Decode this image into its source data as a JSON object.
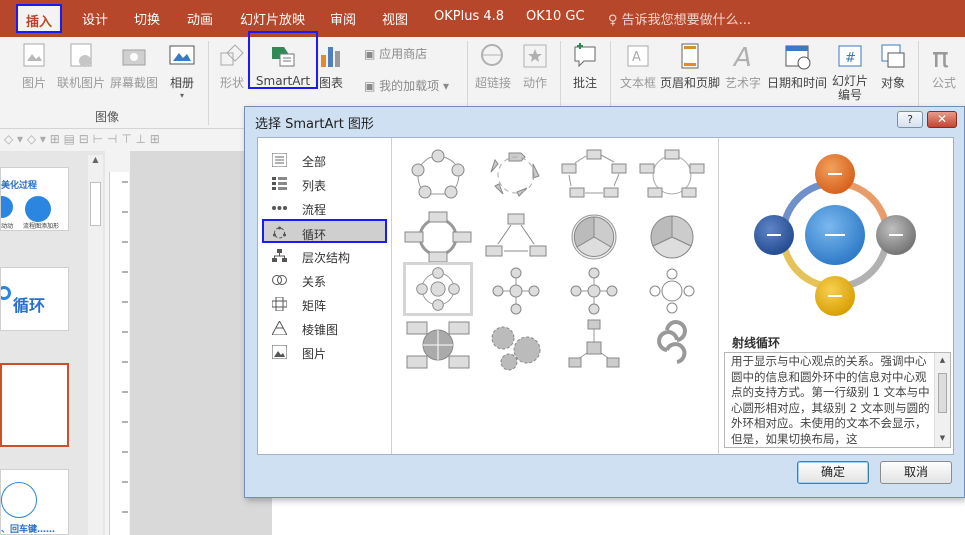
{
  "menu": {
    "tabs": [
      {
        "label": "插入",
        "active": true
      },
      {
        "label": "设计"
      },
      {
        "label": "切换"
      },
      {
        "label": "动画"
      },
      {
        "label": "幻灯片放映"
      },
      {
        "label": "审阅"
      },
      {
        "label": "视图"
      },
      {
        "label": "OKPlus 4.8"
      },
      {
        "label": "OK10 GC"
      }
    ],
    "tell_me": "告诉我您想要做什么..."
  },
  "ribbon": {
    "picture": "图片",
    "online_picture": "联机图片",
    "screenshot": "屏幕截图",
    "album": "相册",
    "group_images": "图像",
    "shapes": "形状",
    "smartart": "SmartArt",
    "chart": "图表",
    "store": "应用商店",
    "my_addins": "我的加载项",
    "hyperlink": "超链接",
    "action": "动作",
    "comment": "批注",
    "textbox": "文本框",
    "header_footer": "页眉和页脚",
    "wordart": "艺术字",
    "datetime": "日期和时间",
    "slide_number": "幻灯片编号",
    "object": "对象",
    "equation": "公式"
  },
  "thumbs": {
    "t1_title": "美化过程",
    "t1_a": "动动",
    "t1_b": "流程图添加形",
    "t2_text": "循环",
    "t5_text": "、回车键……"
  },
  "dialog": {
    "title": "选择 SmartArt 图形",
    "help": "?",
    "close": "✕",
    "categories": [
      {
        "label": "全部",
        "icon": "grid-all-icon"
      },
      {
        "label": "列表",
        "icon": "list-icon"
      },
      {
        "label": "流程",
        "icon": "process-icon"
      },
      {
        "label": "循环",
        "icon": "cycle-icon",
        "selected": true
      },
      {
        "label": "层次结构",
        "icon": "hierarchy-icon"
      },
      {
        "label": "关系",
        "icon": "relationship-icon"
      },
      {
        "label": "矩阵",
        "icon": "matrix-icon"
      },
      {
        "label": "棱锥图",
        "icon": "pyramid-icon"
      },
      {
        "label": "图片",
        "icon": "picture-icon"
      }
    ],
    "preview_name": "射线循环",
    "preview_desc": "用于显示与中心观点的关系。强调中心圆中的信息和圆外环中的信息对中心观点的支持方式。第一行级别 1 文本与中心圆形相对应，其级别 2 文本则与圆的外环相对应。未使用的文本不会显示，但是，如果切换布局，这",
    "ok": "确定",
    "cancel": "取消",
    "colors": {
      "top": "#e0702a",
      "left": "#2f5fa7",
      "right": "#8c8c8c",
      "bottom": "#e0b20f",
      "center": "#3d8bd4"
    }
  }
}
